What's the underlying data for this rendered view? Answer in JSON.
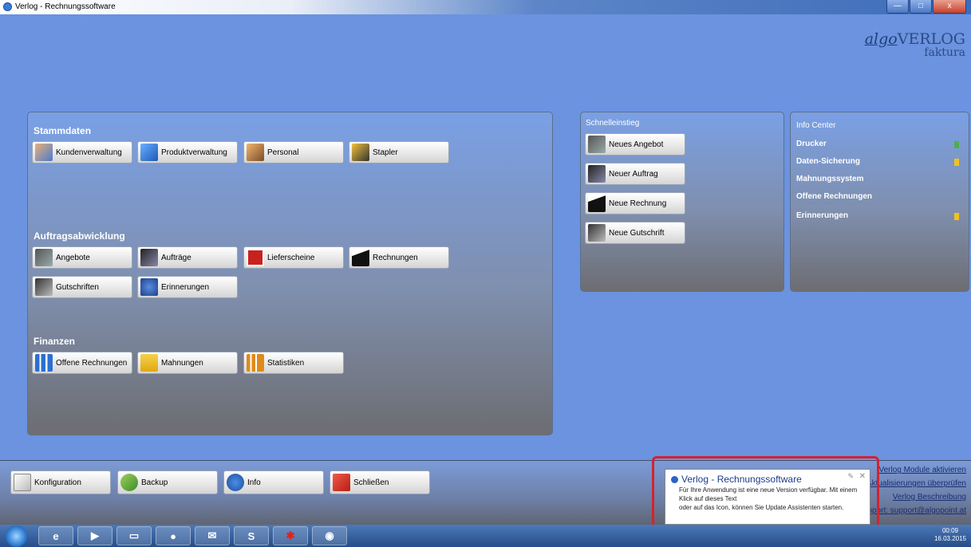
{
  "window": {
    "title": "Verlog - Rechnungssoftware",
    "controls": [
      "—",
      "□",
      "x"
    ]
  },
  "brand": {
    "line1_italic": "algo",
    "line1_rest": "VERLOG",
    "line2": "faktura"
  },
  "stammdaten": {
    "title": "Stammdaten",
    "buttons": [
      {
        "label": "Kundenverwaltung",
        "icon": "customers-icon"
      },
      {
        "label": "Produktverwaltung",
        "icon": "products-icon"
      },
      {
        "label": "Personal",
        "icon": "staff-icon"
      },
      {
        "label": "Stapler",
        "icon": "forklift-icon"
      }
    ]
  },
  "auftrag": {
    "title": "Auftragsabwicklung",
    "buttons": [
      {
        "label": "Angebote",
        "icon": "quote-icon"
      },
      {
        "label": "Aufträge",
        "icon": "orders-icon"
      },
      {
        "label": "Lieferscheine",
        "icon": "delivery-note-icon"
      },
      {
        "label": "Rechnungen",
        "icon": "invoice-icon"
      },
      {
        "label": "Gutschriften",
        "icon": "credit-note-icon"
      },
      {
        "label": "Erinnerungen",
        "icon": "reminder-icon"
      }
    ]
  },
  "finanzen": {
    "title": "Finanzen",
    "buttons": [
      {
        "label": "Offene Rechnungen",
        "icon": "open-invoices-icon"
      },
      {
        "label": "Mahnungen",
        "icon": "dunning-icon"
      },
      {
        "label": "Statistiken",
        "icon": "statistics-icon"
      }
    ]
  },
  "schnell": {
    "title": "Schnelleinstieg",
    "buttons": [
      {
        "label": "Neues Angebot"
      },
      {
        "label": "Neuer Auftrag"
      },
      {
        "label": "Neue Rechnung"
      },
      {
        "label": "Neue Gutschrift"
      }
    ]
  },
  "info_center": {
    "title": "Info Center",
    "items": [
      {
        "label": "Drucker",
        "flag": "#4caf50"
      },
      {
        "label": "Daten-Sicherung",
        "flag": "#f3c11b"
      },
      {
        "label": "Mahnungssystem",
        "flag": ""
      },
      {
        "label": "Offene Rechnungen",
        "flag": ""
      },
      {
        "label": "Erinnerungen",
        "flag": "#f3c11b"
      }
    ]
  },
  "bottom": {
    "buttons": [
      {
        "label": "Konfiguration"
      },
      {
        "label": "Backup"
      },
      {
        "label": "Info"
      },
      {
        "label": "Schließen"
      }
    ]
  },
  "links": [
    "Verlog Module aktivieren",
    "Aktualisierungen überprüfen",
    "Verlog Beschreibung",
    "Support: support@algopoint.at"
  ],
  "notification": {
    "title": "Verlog - Rechnungssoftware",
    "body": "Für Ihre Anwendung ist eine neue Version verfügbar. Mit einem Klick auf dieses Text\noder auf das Icon, können Sie Update Assistenten starten."
  },
  "taskbar": {
    "time": "00:09",
    "date": "16.03.2015"
  },
  "colors": {
    "accent": "#d5222f",
    "panel_title": "#ffffff"
  }
}
